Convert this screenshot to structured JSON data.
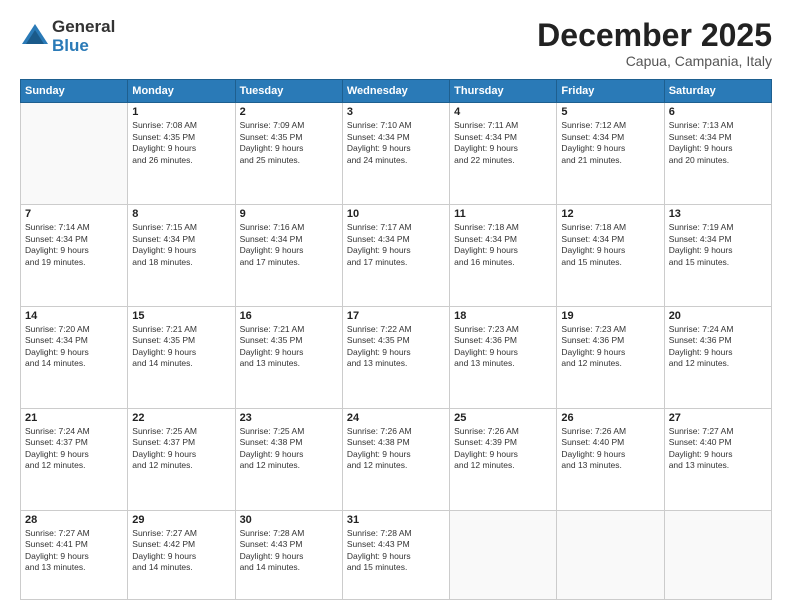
{
  "logo": {
    "general": "General",
    "blue": "Blue"
  },
  "title": "December 2025",
  "location": "Capua, Campania, Italy",
  "weekdays": [
    "Sunday",
    "Monday",
    "Tuesday",
    "Wednesday",
    "Thursday",
    "Friday",
    "Saturday"
  ],
  "weeks": [
    [
      {
        "day": "",
        "info": ""
      },
      {
        "day": "1",
        "info": "Sunrise: 7:08 AM\nSunset: 4:35 PM\nDaylight: 9 hours\nand 26 minutes."
      },
      {
        "day": "2",
        "info": "Sunrise: 7:09 AM\nSunset: 4:35 PM\nDaylight: 9 hours\nand 25 minutes."
      },
      {
        "day": "3",
        "info": "Sunrise: 7:10 AM\nSunset: 4:34 PM\nDaylight: 9 hours\nand 24 minutes."
      },
      {
        "day": "4",
        "info": "Sunrise: 7:11 AM\nSunset: 4:34 PM\nDaylight: 9 hours\nand 22 minutes."
      },
      {
        "day": "5",
        "info": "Sunrise: 7:12 AM\nSunset: 4:34 PM\nDaylight: 9 hours\nand 21 minutes."
      },
      {
        "day": "6",
        "info": "Sunrise: 7:13 AM\nSunset: 4:34 PM\nDaylight: 9 hours\nand 20 minutes."
      }
    ],
    [
      {
        "day": "7",
        "info": "Sunrise: 7:14 AM\nSunset: 4:34 PM\nDaylight: 9 hours\nand 19 minutes."
      },
      {
        "day": "8",
        "info": "Sunrise: 7:15 AM\nSunset: 4:34 PM\nDaylight: 9 hours\nand 18 minutes."
      },
      {
        "day": "9",
        "info": "Sunrise: 7:16 AM\nSunset: 4:34 PM\nDaylight: 9 hours\nand 17 minutes."
      },
      {
        "day": "10",
        "info": "Sunrise: 7:17 AM\nSunset: 4:34 PM\nDaylight: 9 hours\nand 17 minutes."
      },
      {
        "day": "11",
        "info": "Sunrise: 7:18 AM\nSunset: 4:34 PM\nDaylight: 9 hours\nand 16 minutes."
      },
      {
        "day": "12",
        "info": "Sunrise: 7:18 AM\nSunset: 4:34 PM\nDaylight: 9 hours\nand 15 minutes."
      },
      {
        "day": "13",
        "info": "Sunrise: 7:19 AM\nSunset: 4:34 PM\nDaylight: 9 hours\nand 15 minutes."
      }
    ],
    [
      {
        "day": "14",
        "info": "Sunrise: 7:20 AM\nSunset: 4:34 PM\nDaylight: 9 hours\nand 14 minutes."
      },
      {
        "day": "15",
        "info": "Sunrise: 7:21 AM\nSunset: 4:35 PM\nDaylight: 9 hours\nand 14 minutes."
      },
      {
        "day": "16",
        "info": "Sunrise: 7:21 AM\nSunset: 4:35 PM\nDaylight: 9 hours\nand 13 minutes."
      },
      {
        "day": "17",
        "info": "Sunrise: 7:22 AM\nSunset: 4:35 PM\nDaylight: 9 hours\nand 13 minutes."
      },
      {
        "day": "18",
        "info": "Sunrise: 7:23 AM\nSunset: 4:36 PM\nDaylight: 9 hours\nand 13 minutes."
      },
      {
        "day": "19",
        "info": "Sunrise: 7:23 AM\nSunset: 4:36 PM\nDaylight: 9 hours\nand 12 minutes."
      },
      {
        "day": "20",
        "info": "Sunrise: 7:24 AM\nSunset: 4:36 PM\nDaylight: 9 hours\nand 12 minutes."
      }
    ],
    [
      {
        "day": "21",
        "info": "Sunrise: 7:24 AM\nSunset: 4:37 PM\nDaylight: 9 hours\nand 12 minutes."
      },
      {
        "day": "22",
        "info": "Sunrise: 7:25 AM\nSunset: 4:37 PM\nDaylight: 9 hours\nand 12 minutes."
      },
      {
        "day": "23",
        "info": "Sunrise: 7:25 AM\nSunset: 4:38 PM\nDaylight: 9 hours\nand 12 minutes."
      },
      {
        "day": "24",
        "info": "Sunrise: 7:26 AM\nSunset: 4:38 PM\nDaylight: 9 hours\nand 12 minutes."
      },
      {
        "day": "25",
        "info": "Sunrise: 7:26 AM\nSunset: 4:39 PM\nDaylight: 9 hours\nand 12 minutes."
      },
      {
        "day": "26",
        "info": "Sunrise: 7:26 AM\nSunset: 4:40 PM\nDaylight: 9 hours\nand 13 minutes."
      },
      {
        "day": "27",
        "info": "Sunrise: 7:27 AM\nSunset: 4:40 PM\nDaylight: 9 hours\nand 13 minutes."
      }
    ],
    [
      {
        "day": "28",
        "info": "Sunrise: 7:27 AM\nSunset: 4:41 PM\nDaylight: 9 hours\nand 13 minutes."
      },
      {
        "day": "29",
        "info": "Sunrise: 7:27 AM\nSunset: 4:42 PM\nDaylight: 9 hours\nand 14 minutes."
      },
      {
        "day": "30",
        "info": "Sunrise: 7:28 AM\nSunset: 4:43 PM\nDaylight: 9 hours\nand 14 minutes."
      },
      {
        "day": "31",
        "info": "Sunrise: 7:28 AM\nSunset: 4:43 PM\nDaylight: 9 hours\nand 15 minutes."
      },
      {
        "day": "",
        "info": ""
      },
      {
        "day": "",
        "info": ""
      },
      {
        "day": "",
        "info": ""
      }
    ]
  ]
}
